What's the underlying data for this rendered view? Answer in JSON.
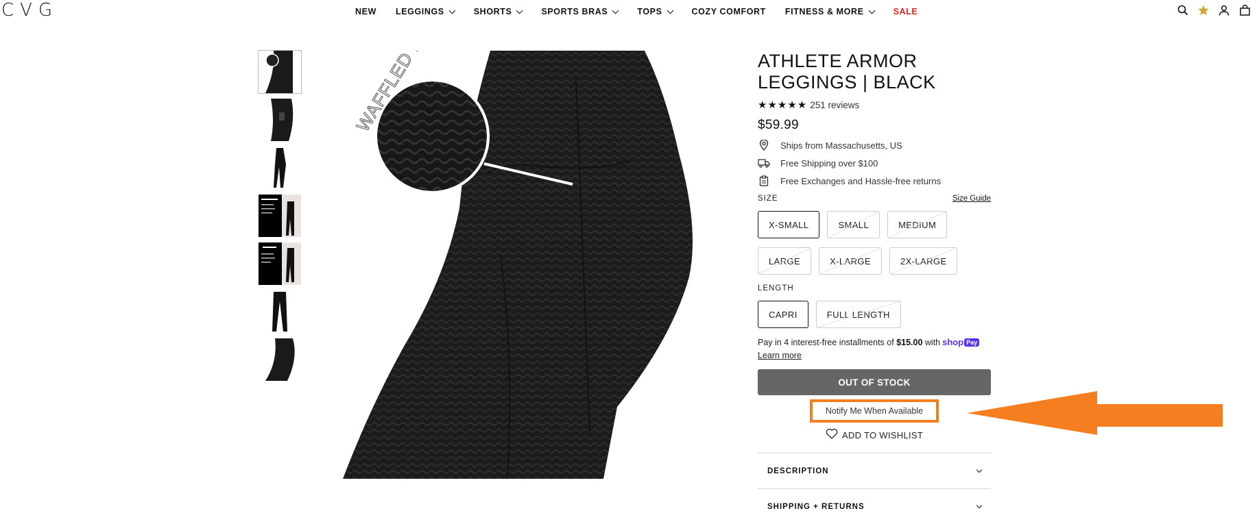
{
  "header": {
    "logo": "CVG",
    "nav": [
      {
        "label": "NEW",
        "has_dropdown": false
      },
      {
        "label": "LEGGINGS",
        "has_dropdown": true
      },
      {
        "label": "SHORTS",
        "has_dropdown": true
      },
      {
        "label": "SPORTS BRAS",
        "has_dropdown": true
      },
      {
        "label": "TOPS",
        "has_dropdown": true
      },
      {
        "label": "COZY COMFORT",
        "has_dropdown": false
      },
      {
        "label": "FITNESS & MORE",
        "has_dropdown": true
      },
      {
        "label": "SALE",
        "has_dropdown": false,
        "color": "#e32222"
      }
    ],
    "icons": [
      "search-icon",
      "star-icon",
      "account-icon",
      "cart-icon"
    ]
  },
  "gallery": {
    "main_image_text": "WAFFLED DESIGN",
    "thumbnail_count": 7
  },
  "product": {
    "title": "ATHLETE ARMOR LEGGINGS | BLACK",
    "stars": "★★★★★",
    "reviews": "251 reviews",
    "price": "$59.99",
    "perks": [
      {
        "icon": "location-pin-icon",
        "text": "Ships from Massachusetts, US"
      },
      {
        "icon": "truck-icon",
        "text": "Free Shipping over $100"
      },
      {
        "icon": "clipboard-icon",
        "text": "Free Exchanges and Hassle-free returns"
      }
    ],
    "size_label": "SIZE",
    "size_guide": "Size Guide",
    "sizes": [
      "X-SMALL",
      "SMALL",
      "MEDIUM",
      "LARGE",
      "X-LARGE",
      "2X-LARGE"
    ],
    "selected_size": "X-SMALL",
    "length_label": "LENGTH",
    "lengths": [
      "CAPRI",
      "FULL LENGTH"
    ],
    "selected_length": "CAPRI",
    "installments_prefix": "Pay in 4 interest-free installments of",
    "installments_amount": "$15.00",
    "installments_with": "with",
    "shop_pay": "shop",
    "shop_pay_pill": "Pay",
    "learn_more": "Learn more",
    "out_of_stock": "OUT OF STOCK",
    "notify": "Notify Me When Available",
    "wishlist": "ADD TO WISHLIST",
    "accordion": [
      "DESCRIPTION",
      "SHIPPING + RETURNS"
    ]
  },
  "colors": {
    "accent_orange": "#f47e20",
    "sale_red": "#e32222",
    "out_of_stock_bg": "#666666",
    "shop_pay": "#5a31f4",
    "star_gold": "#d4a635"
  }
}
